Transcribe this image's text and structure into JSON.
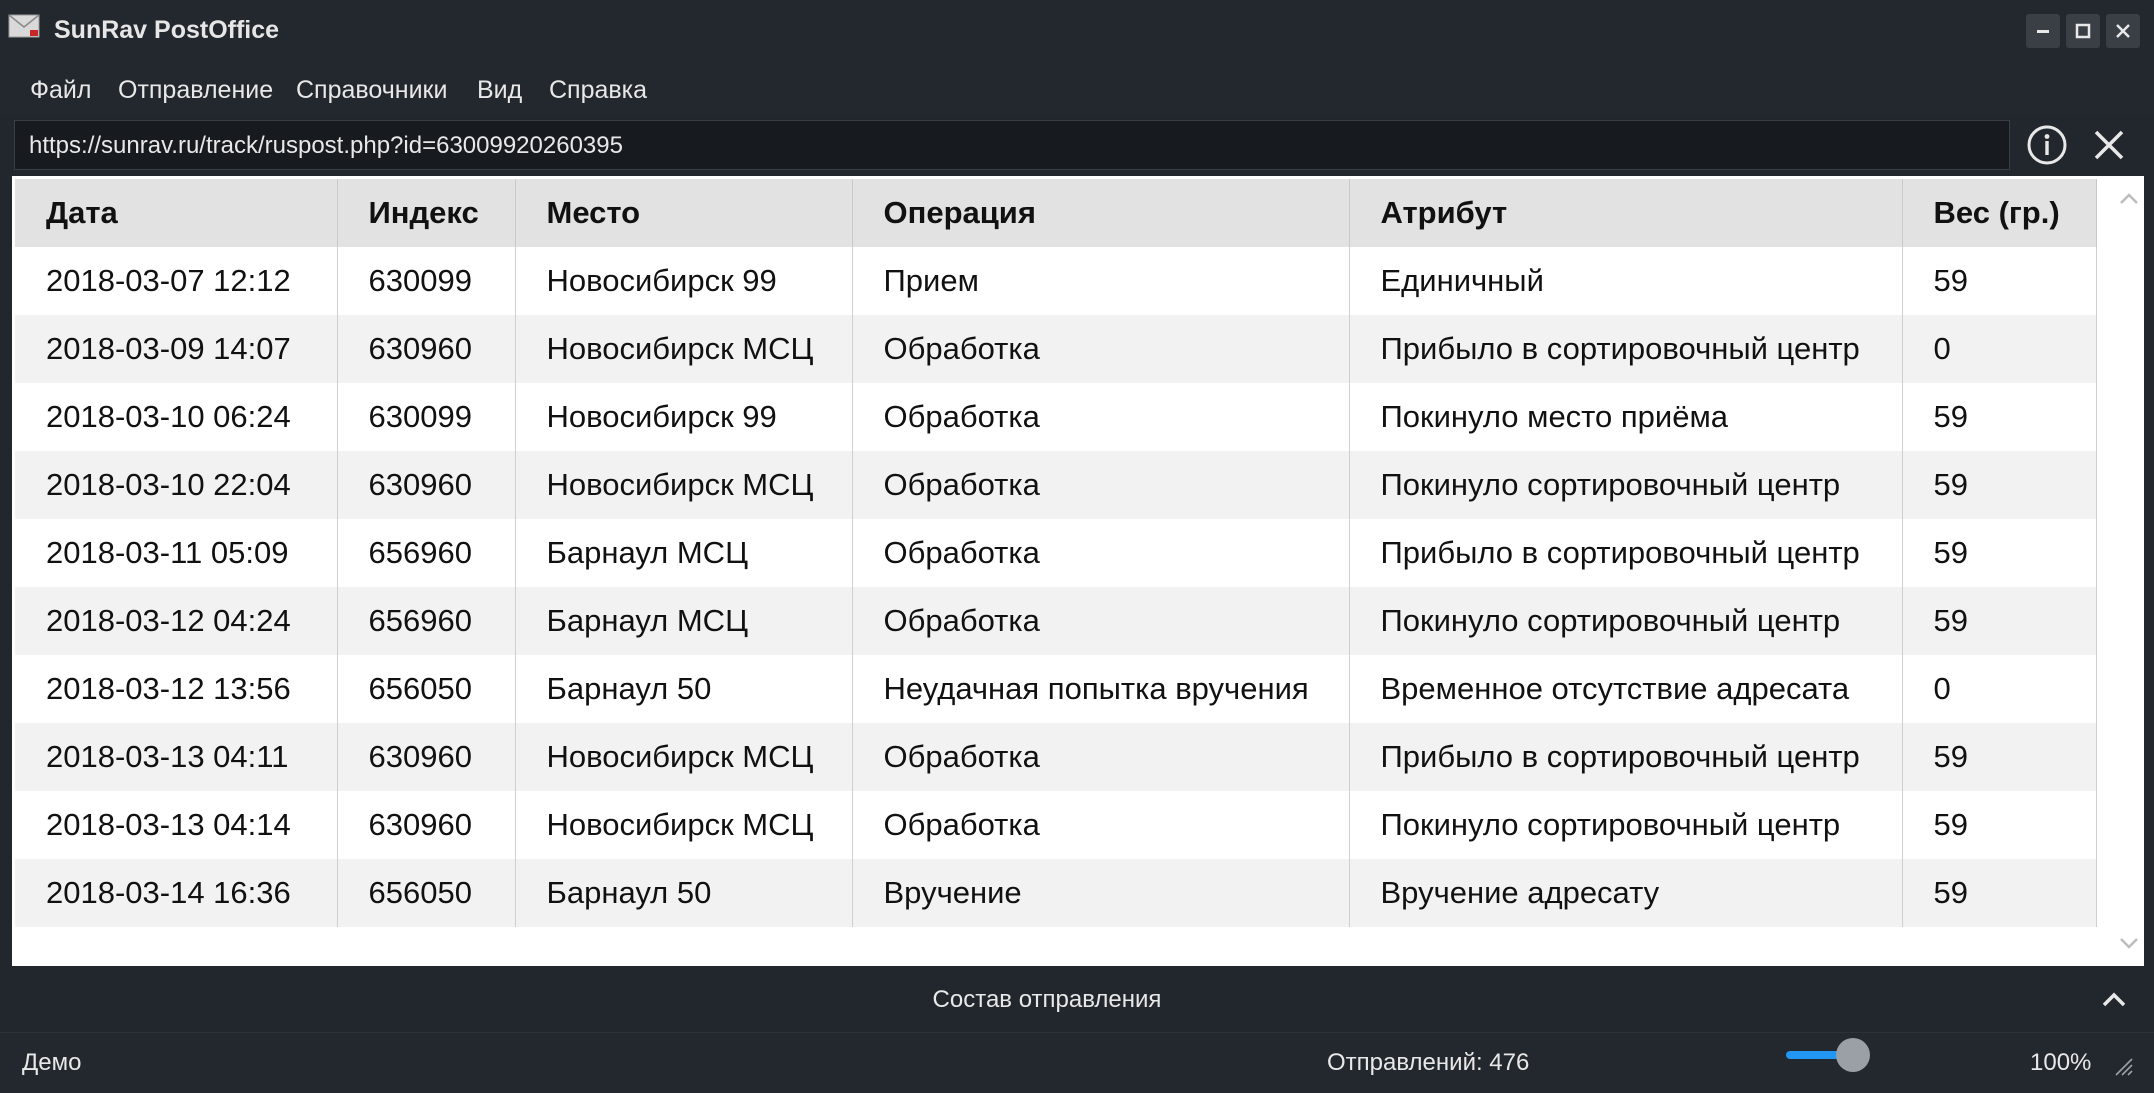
{
  "window": {
    "title": "SunRav PostOffice",
    "controls": [
      "minimize",
      "maximize",
      "close"
    ]
  },
  "menu": {
    "items": [
      {
        "label": "Файл"
      },
      {
        "label": "Отправление"
      },
      {
        "label": "Справочники"
      },
      {
        "label": "Вид"
      },
      {
        "label": "Справка"
      }
    ]
  },
  "address_bar": {
    "url": "https://sunrav.ru/track/ruspost.php?id=63009920260395",
    "info_icon": "info-circle-icon",
    "close_icon": "close-icon"
  },
  "table": {
    "headers": [
      "Дата",
      "Индекс",
      "Место",
      "Операция",
      "Атрибут",
      "Вес (гр.)"
    ],
    "rows": [
      [
        "2018-03-07 12:12",
        "630099",
        "Новосибирск 99",
        "Прием",
        "Единичный",
        "59"
      ],
      [
        "2018-03-09 14:07",
        "630960",
        "Новосибирск МСЦ",
        "Обработка",
        "Прибыло в сортировочный центр",
        "0"
      ],
      [
        "2018-03-10 06:24",
        "630099",
        "Новосибирск 99",
        "Обработка",
        "Покинуло место приёма",
        "59"
      ],
      [
        "2018-03-10 22:04",
        "630960",
        "Новосибирск МСЦ",
        "Обработка",
        "Покинуло сортировочный центр",
        "59"
      ],
      [
        "2018-03-11 05:09",
        "656960",
        "Барнаул МСЦ",
        "Обработка",
        "Прибыло в сортировочный центр",
        "59"
      ],
      [
        "2018-03-12 04:24",
        "656960",
        "Барнаул МСЦ",
        "Обработка",
        "Покинуло сортировочный центр",
        "59"
      ],
      [
        "2018-03-12 13:56",
        "656050",
        "Барнаул 50",
        "Неудачная попытка вручения",
        "Временное отсутствие адресата",
        "0"
      ],
      [
        "2018-03-13 04:11",
        "630960",
        "Новосибирск МСЦ",
        "Обработка",
        "Прибыло в сортировочный центр",
        "59"
      ],
      [
        "2018-03-13 04:14",
        "630960",
        "Новосибирск МСЦ",
        "Обработка",
        "Покинуло сортировочный центр",
        "59"
      ],
      [
        "2018-03-14 16:36",
        "656050",
        "Барнаул 50",
        "Вручение",
        "Вручение адресату",
        "59"
      ]
    ]
  },
  "bottom_panel": {
    "title": "Состав отправления",
    "toggle_icon": "chevron-up-icon"
  },
  "status": {
    "left": "Демо",
    "count_text": "Отправлений: 476",
    "zoom": "100%",
    "zoom_level": 100,
    "accent_color": "#2196f3"
  }
}
